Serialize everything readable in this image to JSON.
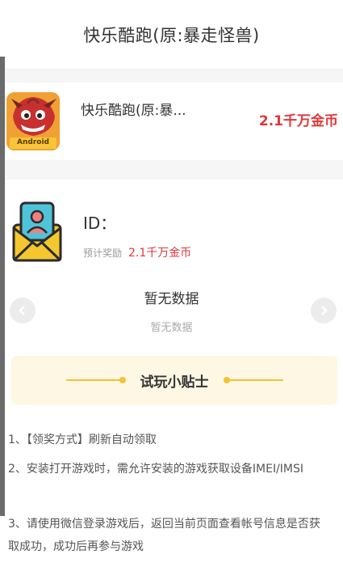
{
  "header": {
    "title": "快乐酷跑(原:暴走怪兽)"
  },
  "game": {
    "name": "快乐酷跑(原:暴...",
    "reward": "2.1千万金币",
    "icon_badge": "Android",
    "icon": "game-monster-icon"
  },
  "user": {
    "id_label": "ID：",
    "reward_label": "预计奖励",
    "reward_amount": "2.1千万金币",
    "avatar_icon": "envelope-user-icon"
  },
  "records": {
    "empty_title": "暂无数据",
    "empty_subtitle": "暂无数据",
    "prev_icon": "chevron-left-icon",
    "next_icon": "chevron-right-icon"
  },
  "tips": {
    "title": "试玩小贴士",
    "items": [
      "1、【领奖方式】刷新自动领取",
      "2、安装打开游戏时，需允许安装的游戏获取设备IMEI/IMSI",
      "3、请使用微信登录游戏后，返回当前页面查看帐号信息是否获取成功，成功后再参与游戏"
    ]
  },
  "colors": {
    "accent_red": "#e0383b",
    "tips_bg": "#fdf7e4",
    "tips_line": "#f3c332"
  }
}
